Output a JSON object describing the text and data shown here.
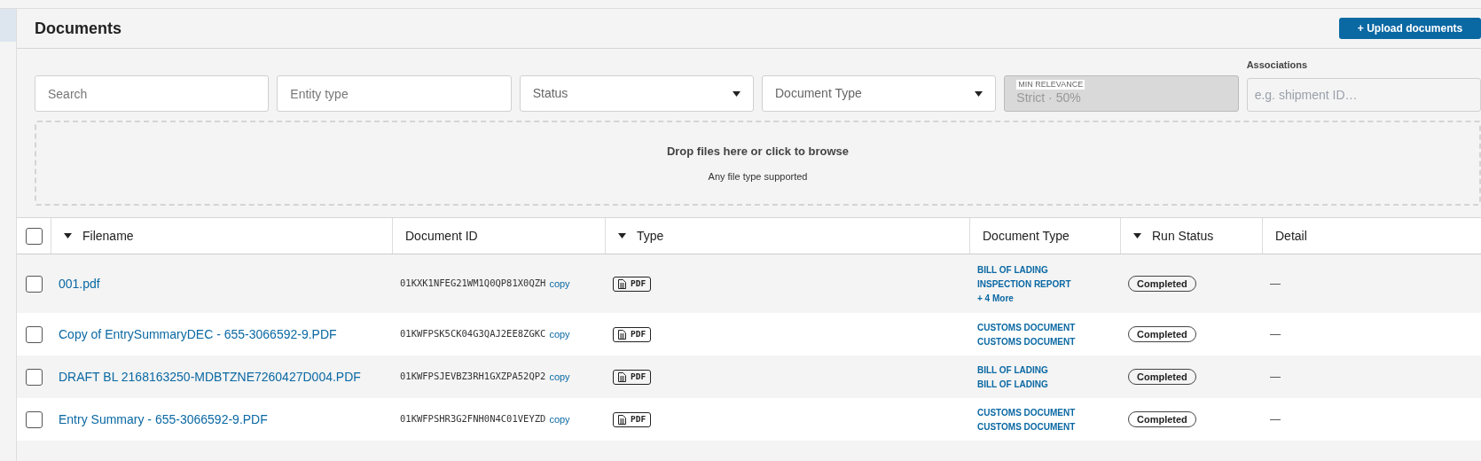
{
  "header": {
    "title": "Documents",
    "upload_button": "+ Upload documents"
  },
  "filters": [
    {
      "kind": "text",
      "placeholder": "Search"
    },
    {
      "kind": "text",
      "placeholder": "Entity type"
    },
    {
      "kind": "select",
      "placeholder": "Status"
    },
    {
      "kind": "select",
      "placeholder": "Document Type"
    },
    {
      "kind": "readonly",
      "label": "MIN RELEVANCE",
      "value": "Strict · 50%"
    },
    {
      "kind": "labeled",
      "label": "Associations",
      "placeholder": "e.g. shipment ID…"
    }
  ],
  "dropzone": {
    "title": "Drop files here or click to browse",
    "subtitle": "Any file type supported"
  },
  "table": {
    "select_all": {
      "checked": false
    },
    "columns": [
      {
        "label": "Filename",
        "sortable": true
      },
      {
        "label": "Document ID",
        "sortable": false
      },
      {
        "label": "Type",
        "sortable": true
      },
      {
        "label": "Document Type",
        "sortable": false
      },
      {
        "label": "Run Status",
        "sortable": true
      },
      {
        "label": "Detail",
        "sortable": false
      }
    ],
    "rows": [
      {
        "checked": false,
        "filename": "001.pdf",
        "document_id": "01KXK1NFEG21WM1Q0QP81X0QZH",
        "copy": "copy",
        "type": "PDF",
        "document_types": [
          "BILL OF LADING",
          "INSPECTION REPORT"
        ],
        "more": "+ 4 More",
        "run_status": "Completed",
        "detail": "—"
      },
      {
        "checked": false,
        "filename": "Copy of EntrySummaryDEC - 655-3066592-9.PDF",
        "document_id": "01KWFPSK5CK04G3QAJ2EE8ZGKC",
        "copy": "copy",
        "type": "PDF",
        "document_types": [
          "CUSTOMS DOCUMENT",
          "CUSTOMS DOCUMENT"
        ],
        "run_status": "Completed",
        "detail": "—"
      },
      {
        "checked": false,
        "filename": "DRAFT BL 2168163250-MDBTZNE7260427D004.PDF",
        "document_id": "01KWFPSJEVBZ3RH1GXZPA52QP2",
        "copy": "copy",
        "type": "PDF",
        "document_types": [
          "BILL OF LADING",
          "BILL OF LADING"
        ],
        "run_status": "Completed",
        "detail": "—"
      },
      {
        "checked": false,
        "filename": "Entry Summary - 655-3066592-9.PDF",
        "document_id": "01KWFPSHR3G2FNH0N4C01VEYZD",
        "copy": "copy",
        "type": "PDF",
        "document_types": [
          "CUSTOMS DOCUMENT",
          "CUSTOMS DOCUMENT"
        ],
        "run_status": "Completed",
        "detail": "—"
      }
    ]
  }
}
